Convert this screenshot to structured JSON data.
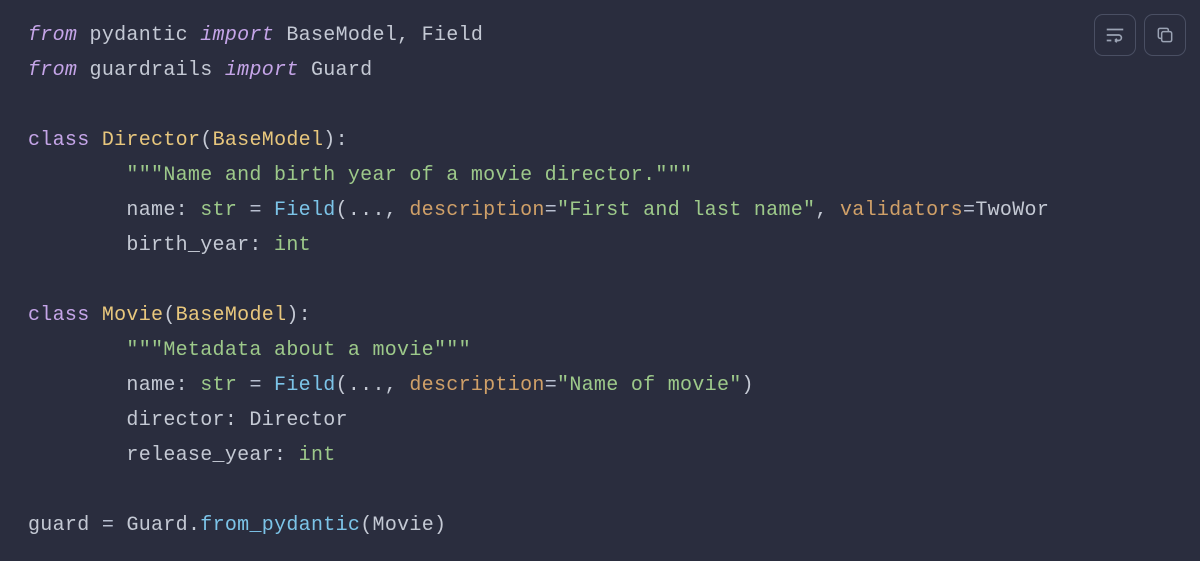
{
  "toolbar": {
    "wrap_label": "wrap-icon",
    "copy_label": "copy-icon"
  },
  "code": {
    "l1_from": "from",
    "l1_mod1": " pydantic ",
    "l1_import": "import",
    "l1_names": " BaseModel, Field",
    "l2_from": "from",
    "l2_mod": " guardrails ",
    "l2_import": "import",
    "l2_name": " Guard",
    "l4_class": "class",
    "l4_sp": " ",
    "l4_name": "Director",
    "l4_open": "(",
    "l4_base": "BaseModel",
    "l4_close": "):",
    "l5_doc": "        \"\"\"Name and birth year of a movie director.\"\"\"",
    "l6_ind": "        name: ",
    "l6_type": "str",
    "l6_eq": " = ",
    "l6_fn": "Field",
    "l6_open": "(..., ",
    "l6_p1": "description",
    "l6_eq2": "=",
    "l6_v1": "\"First and last name\"",
    "l6_comma": ", ",
    "l6_p2": "validators",
    "l6_eq3": "=",
    "l6_v2": "TwoWor",
    "l7": "        birth_year: ",
    "l7_type": "int",
    "l9_class": "class",
    "l9_sp": " ",
    "l9_name": "Movie",
    "l9_open": "(",
    "l9_base": "BaseModel",
    "l9_close": "):",
    "l10_doc": "        \"\"\"Metadata about a movie\"\"\"",
    "l11_ind": "        name: ",
    "l11_type": "str",
    "l11_eq": " = ",
    "l11_fn": "Field",
    "l11_open": "(..., ",
    "l11_p1": "description",
    "l11_eq2": "=",
    "l11_v1": "\"Name of movie\"",
    "l11_close": ")",
    "l12": "        director: Director",
    "l13": "        release_year: ",
    "l13_type": "int",
    "l15_var": "guard ",
    "l15_eq": "=",
    "l15_sp": " ",
    "l15_obj": "Guard",
    "l15_dot": ".",
    "l15_fn": "from_pydantic",
    "l15_open": "(",
    "l15_arg": "Movie",
    "l15_close": ")"
  }
}
